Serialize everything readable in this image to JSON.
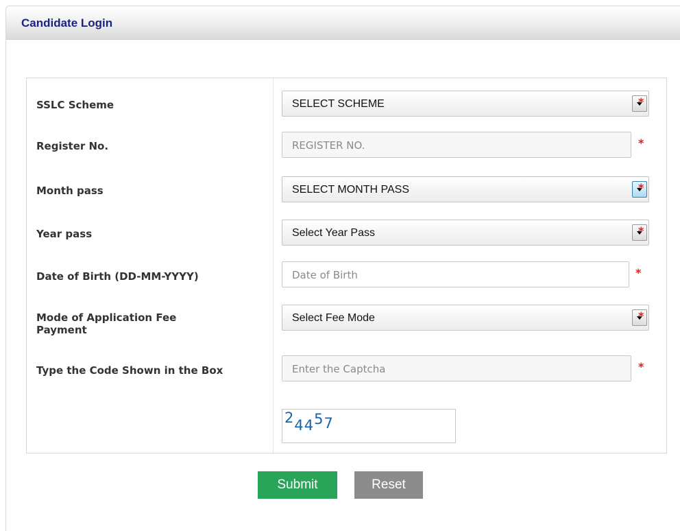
{
  "header": {
    "title": "Candidate Login"
  },
  "form": {
    "required_mark": "*",
    "fields": {
      "scheme": {
        "label": "SSLC Scheme",
        "value": "SELECT SCHEME"
      },
      "register": {
        "label": "Register No.",
        "placeholder": "REGISTER NO."
      },
      "month": {
        "label": "Month pass",
        "value": "SELECT MONTH PASS"
      },
      "year": {
        "label": "Year pass",
        "value": "Select Year Pass"
      },
      "dob": {
        "label": "Date of Birth (DD-MM-YYYY)",
        "placeholder": "Date of Birth"
      },
      "fee_mode": {
        "label": "Mode of Application Fee Payment",
        "value": "Select Fee Mode"
      },
      "captcha_input": {
        "label": "Type the Code Shown in the Box",
        "placeholder": "Enter the Captcha"
      }
    },
    "captcha": {
      "digits": [
        "2",
        "4",
        "4",
        "5",
        "7"
      ]
    }
  },
  "buttons": {
    "submit": "Submit",
    "reset": "Reset"
  }
}
